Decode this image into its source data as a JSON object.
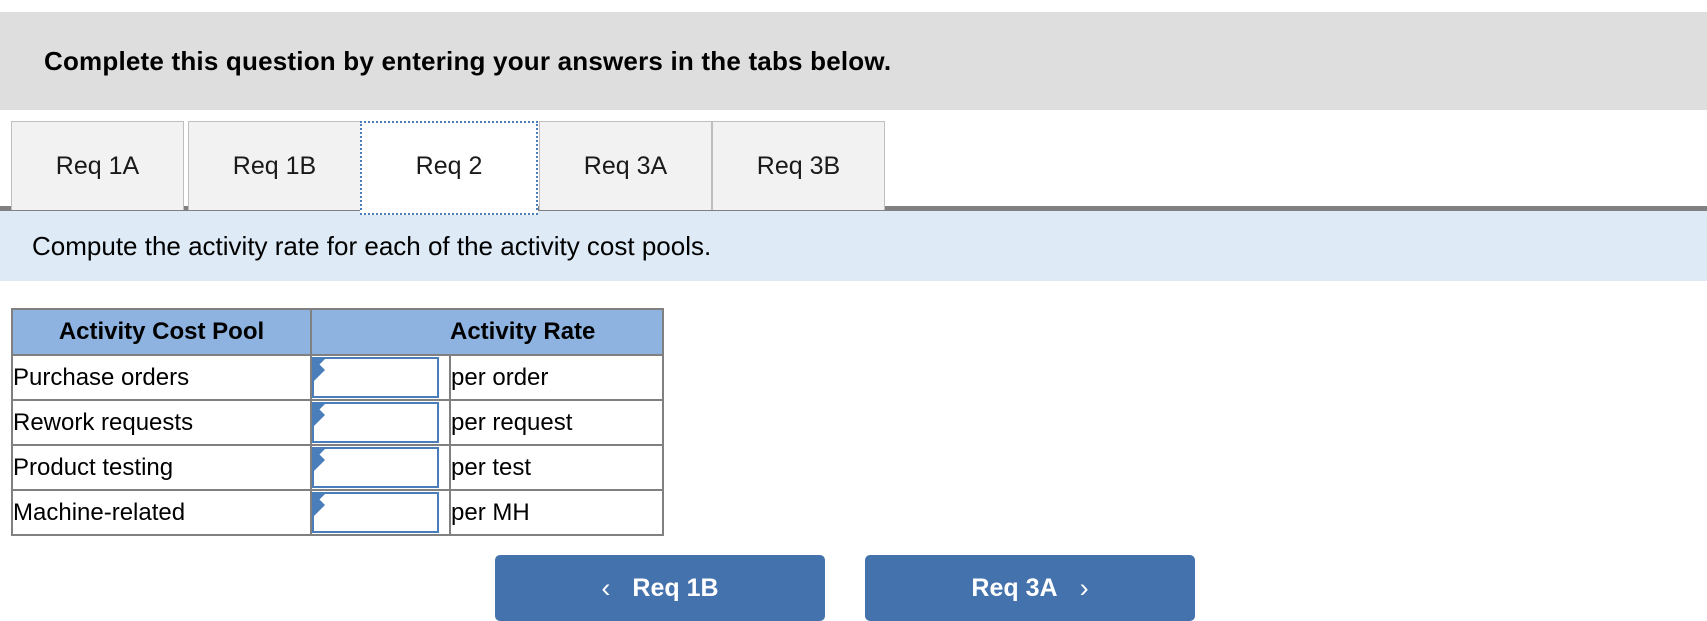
{
  "banner": {
    "text": "Complete this question by entering your answers in the tabs below."
  },
  "tabs": [
    {
      "label": "Req 1A",
      "active": false
    },
    {
      "label": "Req 1B",
      "active": false
    },
    {
      "label": "Req 2",
      "active": true
    },
    {
      "label": "Req 3A",
      "active": false
    },
    {
      "label": "Req 3B",
      "active": false
    }
  ],
  "instruction": {
    "text": "Compute the activity rate for each of the activity cost pools."
  },
  "table": {
    "headers": [
      "Activity Cost Pool",
      "Activity Rate"
    ],
    "rows": [
      {
        "pool": "Purchase orders",
        "value": "",
        "unit": "per order"
      },
      {
        "pool": "Rework requests",
        "value": "",
        "unit": "per request"
      },
      {
        "pool": "Product testing",
        "value": "",
        "unit": "per test"
      },
      {
        "pool": "Machine-related",
        "value": "",
        "unit": "per MH"
      }
    ]
  },
  "nav": {
    "prev_label": "Req 1B",
    "prev_icon": "chevron-left-icon",
    "prev_chevron": "‹",
    "next_label": "Req 3A",
    "next_icon": "chevron-right-icon",
    "next_chevron": "›"
  },
  "colors": {
    "banner_bg": "#dedede",
    "instruction_bg": "#deeaf6",
    "table_header_bg": "#8eb3e0",
    "accent_blue": "#4a7ebb",
    "button_blue": "#4472ac",
    "border_gray": "#808080"
  }
}
